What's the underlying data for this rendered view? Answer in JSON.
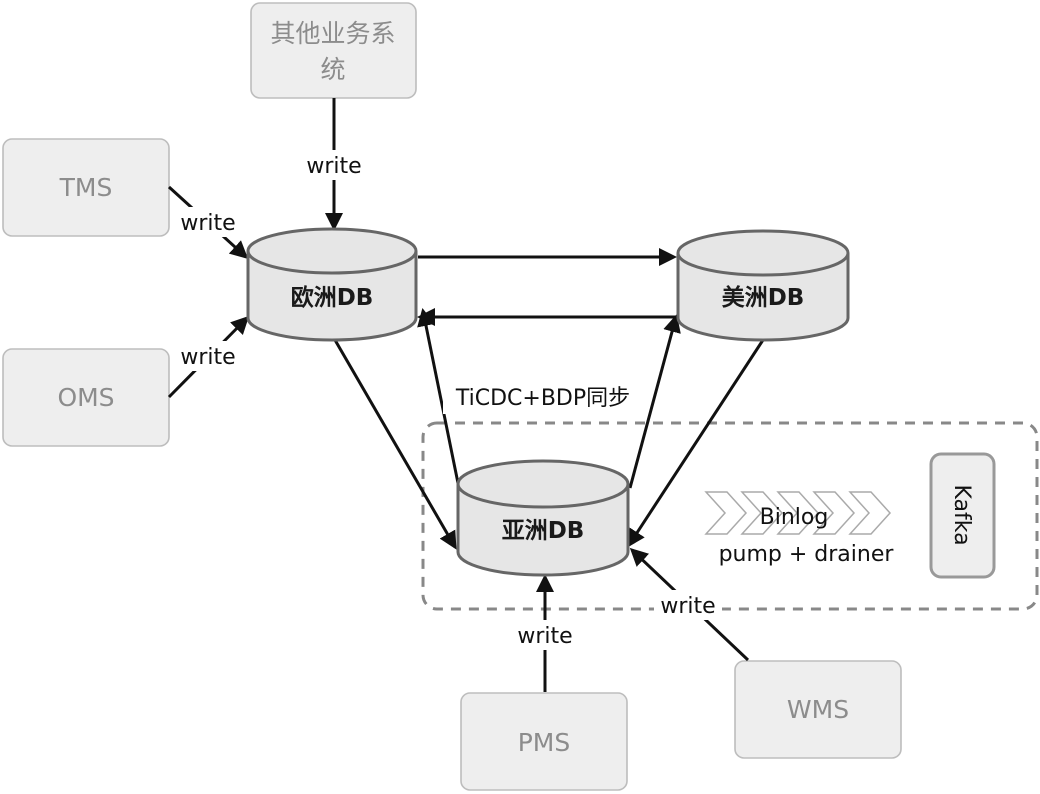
{
  "systems": {
    "other": {
      "line1": "其他业务系",
      "line2": "统"
    },
    "tms": "TMS",
    "oms": "OMS",
    "pms": "PMS",
    "wms": "WMS"
  },
  "databases": {
    "europe": "欧洲DB",
    "america": "美洲DB",
    "asia": "亚洲DB"
  },
  "edge_labels": {
    "write": "write",
    "sync": "TiCDC+BDP同步"
  },
  "binlog": {
    "line1": "Binlog",
    "line2": "pump + drainer"
  },
  "kafka": "Kafka",
  "colors": {
    "system_fill": "#eeeeee",
    "system_text": "#8c8c8c",
    "db_fill": "#e6e6e6",
    "db_stroke": "#666666",
    "dashed_border": "#888888"
  }
}
